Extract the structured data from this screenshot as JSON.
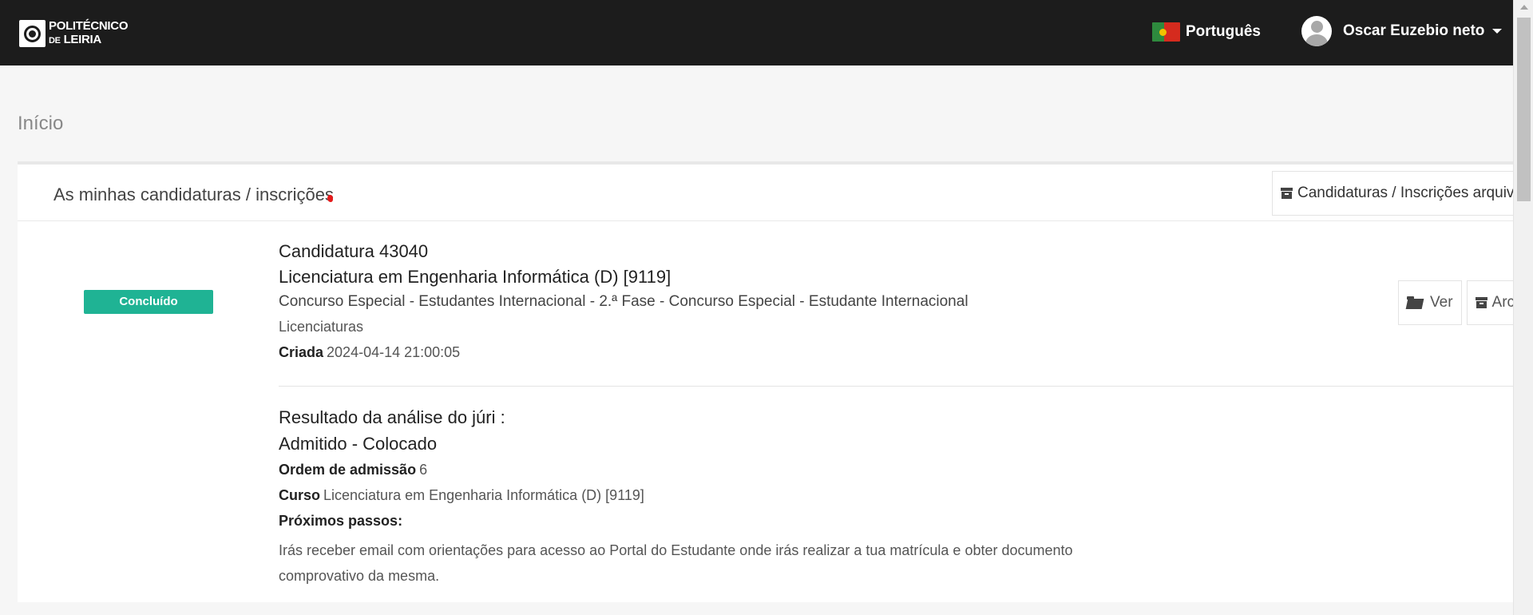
{
  "header": {
    "logo": {
      "line1": "POLITÉCNICO",
      "line2_small": "DE",
      "line2": "LEIRIA"
    },
    "language": "Português",
    "user_name": "Oscar Euzebio neto"
  },
  "breadcrumb": "Início",
  "panel": {
    "title": "As minhas candidaturas / inscrições",
    "archived_button": "Candidaturas / Inscrições arquiv"
  },
  "application": {
    "status": "Concluído",
    "title": "Candidatura 43040",
    "course": "Licenciatura em Engenharia Informática (D) [9119]",
    "contest": "Concurso Especial - Estudantes Internacional - 2.ª Fase - Concurso Especial - Estudante Internacional",
    "degree": "Licenciaturas",
    "created_label": "Criada",
    "created_value": "2024-04-14 21:00:05",
    "actions": {
      "view": "Ver",
      "archive": "Arc"
    }
  },
  "result": {
    "title": "Resultado da análise do júri :",
    "status": "Admitido - Colocado",
    "order_label": "Ordem de admissão",
    "order_value": "6",
    "course_label": "Curso",
    "course_value": "Licenciatura em Engenharia Informática (D) [9119]",
    "next_label": "Próximos passos:",
    "next_text": "Irás receber email com orientações para acesso ao Portal do Estudante onde irás realizar a tua matrícula e obter documento comprovativo da mesma."
  },
  "colors": {
    "navbar": "#1c1c1c",
    "status_badge": "#1fb394",
    "page_background": "#f6f6f6"
  }
}
